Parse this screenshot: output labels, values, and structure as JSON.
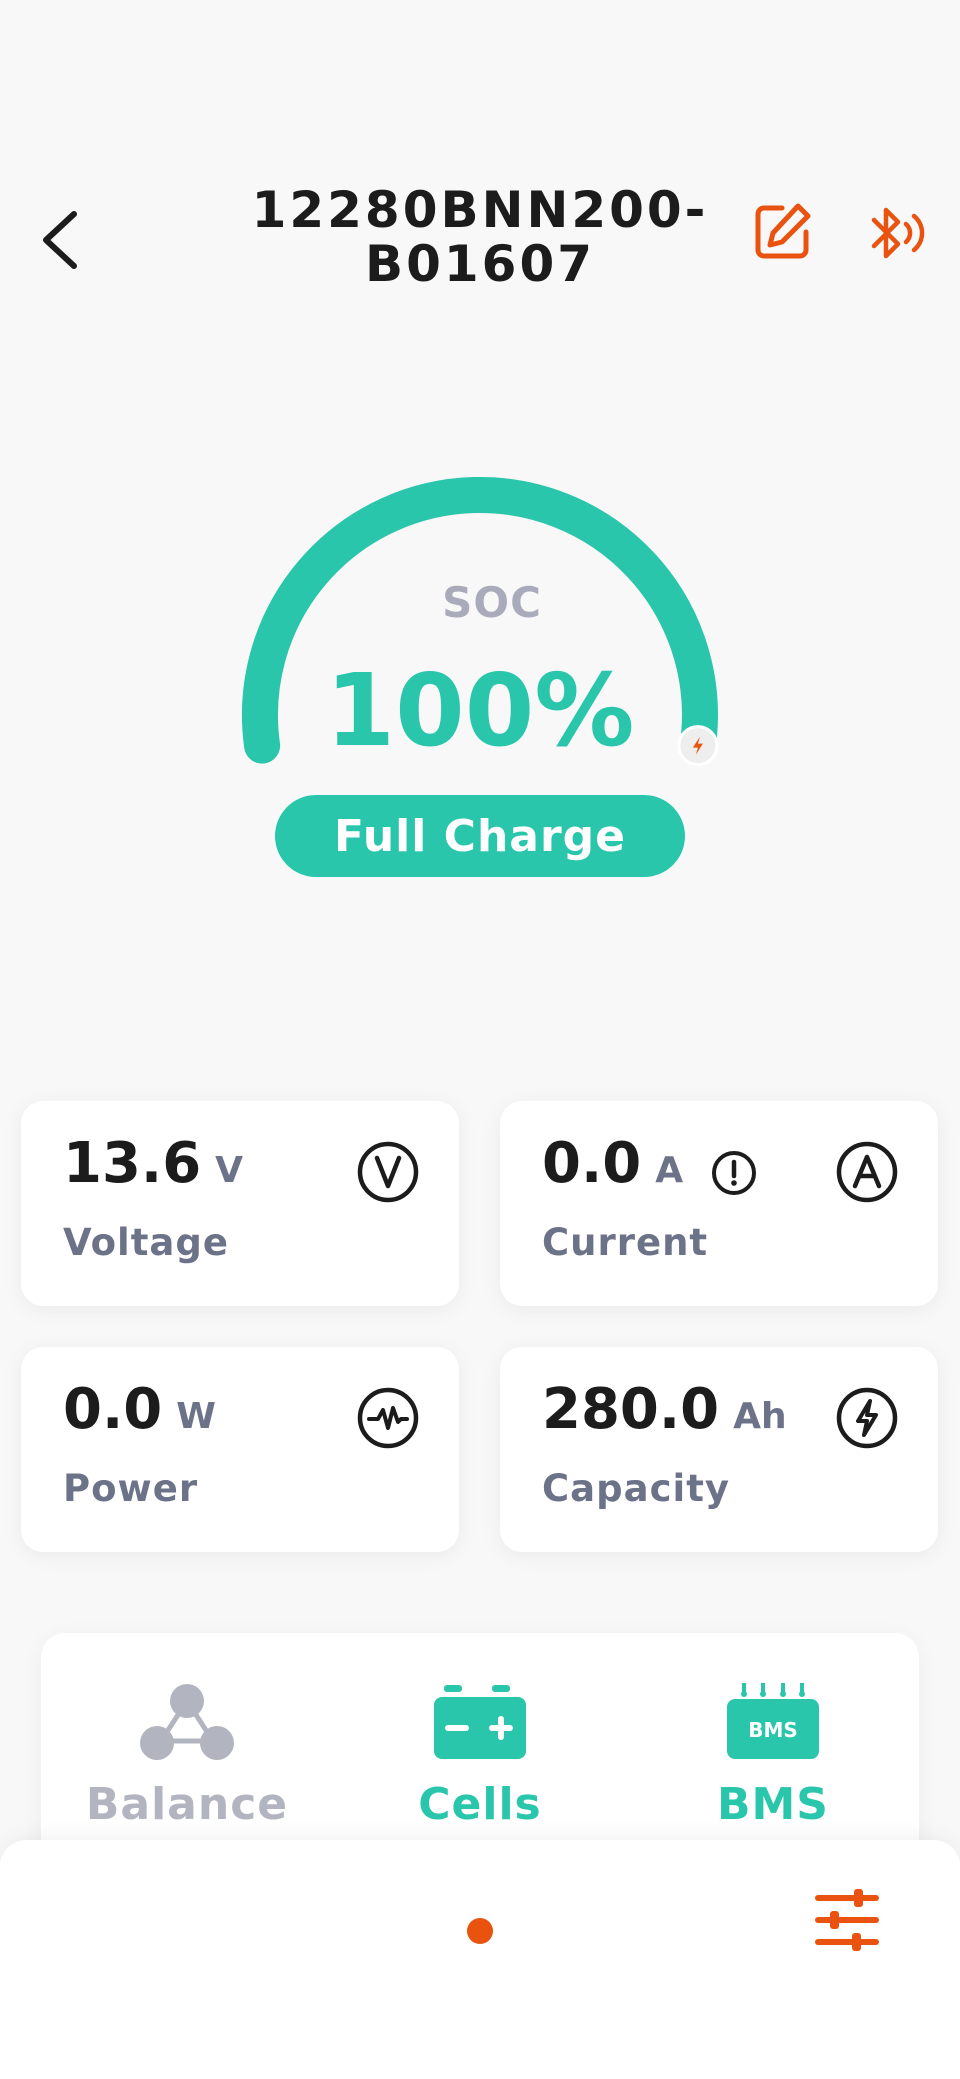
{
  "header": {
    "title_line1": "12280BNN200-",
    "title_line2": "B01607",
    "back_icon": "chevron-left-icon",
    "edit_icon": "edit-icon",
    "bluetooth_icon": "bluetooth-connected-icon"
  },
  "soc": {
    "label": "SOC",
    "value": "100%",
    "percent": 100,
    "status": "Full Charge",
    "status_icon": "bolt-icon"
  },
  "metrics": {
    "voltage": {
      "value": "13.6",
      "unit": "V",
      "label": "Voltage",
      "icon": "volt-icon"
    },
    "current": {
      "value": "0.0",
      "unit": "A",
      "label": "Current",
      "icon": "ampere-icon",
      "warning_icon": "info-icon"
    },
    "power": {
      "value": "0.0",
      "unit": "W",
      "label": "Power",
      "icon": "pulse-icon"
    },
    "capacity": {
      "value": "280.0",
      "unit": "Ah",
      "label": "Capacity",
      "icon": "bolt-circle-icon"
    }
  },
  "tools": [
    {
      "label": "Balance",
      "icon": "balance-icon",
      "active": false
    },
    {
      "label": "Cells",
      "icon": "battery-cells-icon",
      "active": true
    },
    {
      "label": "BMS",
      "icon": "bms-icon",
      "active": true,
      "icon_text": "BMS"
    }
  ],
  "bottom_bar": {
    "settings_icon": "sliders-icon"
  },
  "colors": {
    "accent": "#2ac6ab",
    "orange": "#e9530f",
    "muted": "#a9abba",
    "label": "#6c7389",
    "text": "#1c1c1c"
  }
}
